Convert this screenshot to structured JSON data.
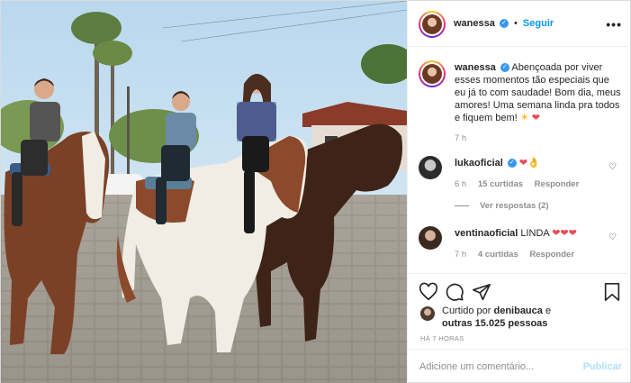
{
  "header": {
    "username": "wanessa",
    "separator": "•",
    "follow_label": "Seguir",
    "more_icon": "more-options-icon"
  },
  "caption": {
    "username": "wanessa",
    "text": "Abençoada por viver esses momentos tão especiais que eu já to com saudade! Bom dia, meus amores! Uma semana linda pra todos e fiquem bem!",
    "emojis": "☀❤",
    "time": "7 h"
  },
  "comments": [
    {
      "username": "lukaoficial",
      "text": "❤👌",
      "time": "6 h",
      "likes": "15 curtidas",
      "reply": "Responder",
      "view_replies": "Ver respostas (2)"
    },
    {
      "username": "ventinaoficial",
      "text": "LINDA",
      "hearts": "❤❤❤",
      "time": "7 h",
      "likes": "4 curtidas",
      "reply": "Responder"
    }
  ],
  "actions": {
    "like_icon": "heart-icon",
    "comment_icon": "comment-icon",
    "share_icon": "share-icon",
    "save_icon": "bookmark-icon"
  },
  "likes": {
    "prefix": "Curtido por",
    "user": "denibauca",
    "middle": "e",
    "others": "outras 15.025 pessoas"
  },
  "timestamp": "HÁ 7 HORAS",
  "add_comment": {
    "placeholder": "Adicione um comentário...",
    "publish_label": "Publicar"
  },
  "colors": {
    "link_blue": "#0095f6",
    "publish_disabled": "#b2dffc",
    "heart_red": "#ed4956",
    "muted": "#8e8e8e"
  }
}
